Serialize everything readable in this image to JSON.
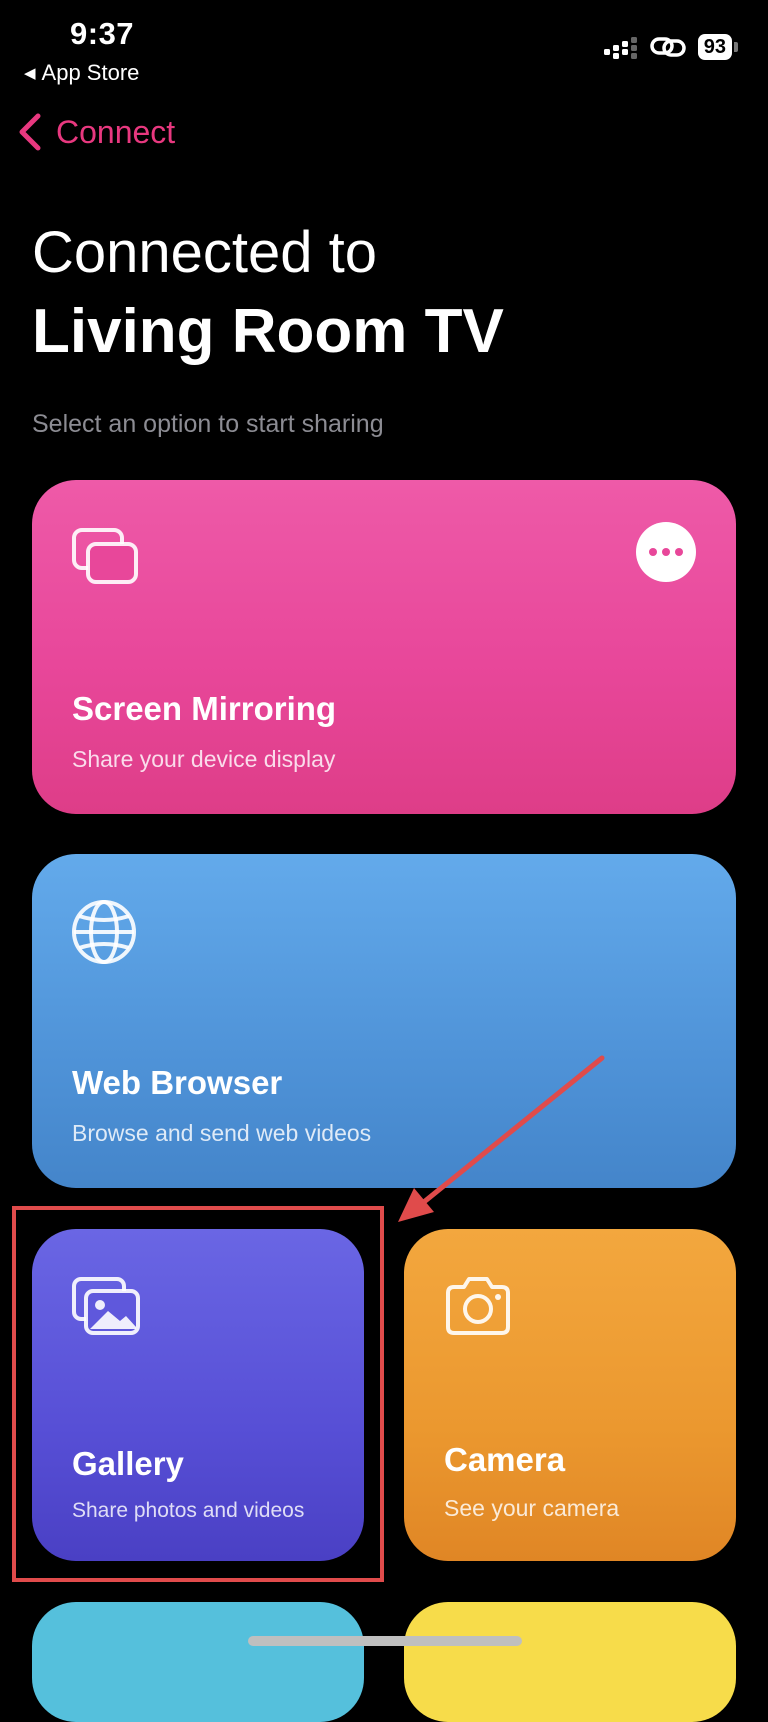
{
  "status_bar": {
    "time": "9:37",
    "back_app_label": "App Store",
    "battery": "93"
  },
  "nav": {
    "back_label": "Connect",
    "accent_color": "#e8387f"
  },
  "header": {
    "title_line1": "Connected to",
    "title_line2": "Living Room TV",
    "subtitle": "Select an option to start sharing"
  },
  "cards": [
    {
      "title": "Screen Mirroring",
      "subtitle": "Share your device display",
      "icon": "screens-icon",
      "color": "#e8479a"
    },
    {
      "title": "Web Browser",
      "subtitle": "Browse and send web videos",
      "icon": "globe-icon",
      "color": "#4f93d8"
    },
    {
      "title": "Gallery",
      "subtitle": "Share photos and videos",
      "icon": "photos-icon",
      "color": "#574fd6"
    },
    {
      "title": "Camera",
      "subtitle": "See your camera",
      "icon": "camera-icon",
      "color": "#eb982f"
    }
  ],
  "annotation": {
    "highlight_color": "#e04b4b"
  }
}
